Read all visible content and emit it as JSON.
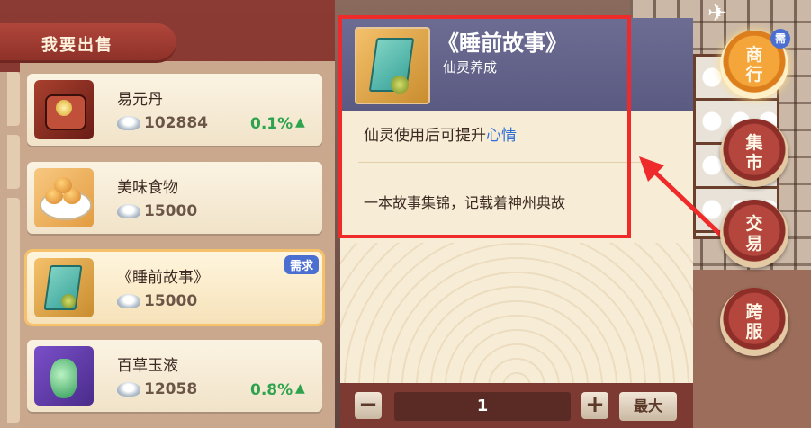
{
  "sell_tab": {
    "label": "我要出售"
  },
  "items": [
    {
      "name": "易元丹",
      "price": "102884",
      "change": "0.1%",
      "trend": "up",
      "badge": "",
      "icon": "elixir-box-icon"
    },
    {
      "name": "美味食物",
      "price": "15000",
      "change": "",
      "trend": "",
      "badge": "",
      "icon": "buns-plate-icon"
    },
    {
      "name": "《睡前故事》",
      "price": "15000",
      "change": "",
      "trend": "",
      "badge": "需求",
      "icon": "storybook-icon",
      "selected": true
    },
    {
      "name": "百草玉液",
      "price": "12058",
      "change": "0.8%",
      "trend": "up",
      "badge": "",
      "icon": "jade-vase-icon"
    }
  ],
  "detail": {
    "title": "《睡前故事》",
    "subtitle": "仙灵养成",
    "desc_prefix": "仙灵使用后可提升",
    "desc_highlight": "心情",
    "description": "一本故事集锦，记载着神州典故"
  },
  "quantity": {
    "minus": "−",
    "value": "1",
    "plus": "+",
    "max_label": "最大"
  },
  "nav": [
    {
      "label_top": "商",
      "label_bottom": "行",
      "badge": "需",
      "active": true
    },
    {
      "label_top": "集",
      "label_bottom": "市",
      "badge": "",
      "active": false
    },
    {
      "label_top": "交",
      "label_bottom": "易",
      "badge": "",
      "active": false
    },
    {
      "label_top": "跨",
      "label_bottom": "服",
      "badge": "",
      "active": false
    }
  ],
  "colors": {
    "highlight_box": "#ef2a2a",
    "trend_up": "#2ea34d",
    "desc_highlight": "#2f6fd6"
  }
}
